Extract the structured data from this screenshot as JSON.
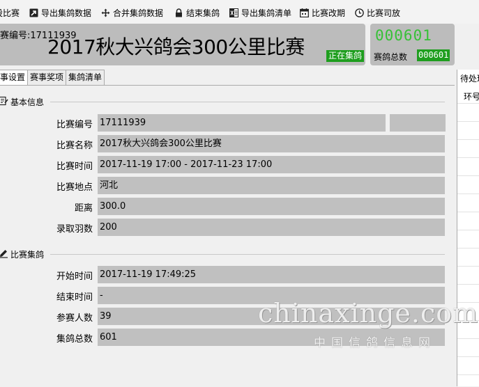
{
  "toolbar": {
    "items": [
      {
        "label": "设比赛",
        "icon": "doc-icon"
      },
      {
        "label": "导出集鸽数据",
        "icon": "export-icon"
      },
      {
        "label": "合并集鸽数据",
        "icon": "move-icon"
      },
      {
        "label": "结束集鸽",
        "icon": "lock-icon"
      },
      {
        "label": "导出集鸽清单",
        "icon": "excel-icon"
      },
      {
        "label": "比赛改期",
        "icon": "calendar-icon"
      },
      {
        "label": "比赛司放",
        "icon": "clock-icon"
      }
    ]
  },
  "header": {
    "race_no": "赛编号:17111939",
    "title": "2017秋大兴鸽会300公里比赛",
    "status": "正在集鸽"
  },
  "counter": {
    "big": "000601",
    "label": "赛鸽总数",
    "small": "000601"
  },
  "tabs": [
    "事设置",
    "赛事奖项",
    "集鸽清单"
  ],
  "basic_info": {
    "heading": "基本信息",
    "rows": [
      {
        "label": "比赛编号",
        "value": "17111939"
      },
      {
        "label": "比赛名称",
        "value": "2017秋大兴鸽会300公里比赛"
      },
      {
        "label": "比赛时间",
        "value": "2017-11-19 17:00 - 2017-11-23 17:00"
      },
      {
        "label": "比赛地点",
        "value": "河北"
      },
      {
        "label": "距离",
        "value": "300.0"
      },
      {
        "label": "录取羽数",
        "value": "200"
      }
    ]
  },
  "collection": {
    "heading": "比赛集鸽",
    "rows": [
      {
        "label": "开始时间",
        "value": "2017-11-19 17:49:25"
      },
      {
        "label": "结束时间",
        "value": "-"
      },
      {
        "label": "参赛人数",
        "value": "39"
      },
      {
        "label": "集鸽总数",
        "value": "601"
      }
    ]
  },
  "right_panel": {
    "title": "待处理",
    "column": "环号"
  },
  "watermark": {
    "text": "chinaxinge.com",
    "text_cn": "中国信鸽信息网"
  }
}
